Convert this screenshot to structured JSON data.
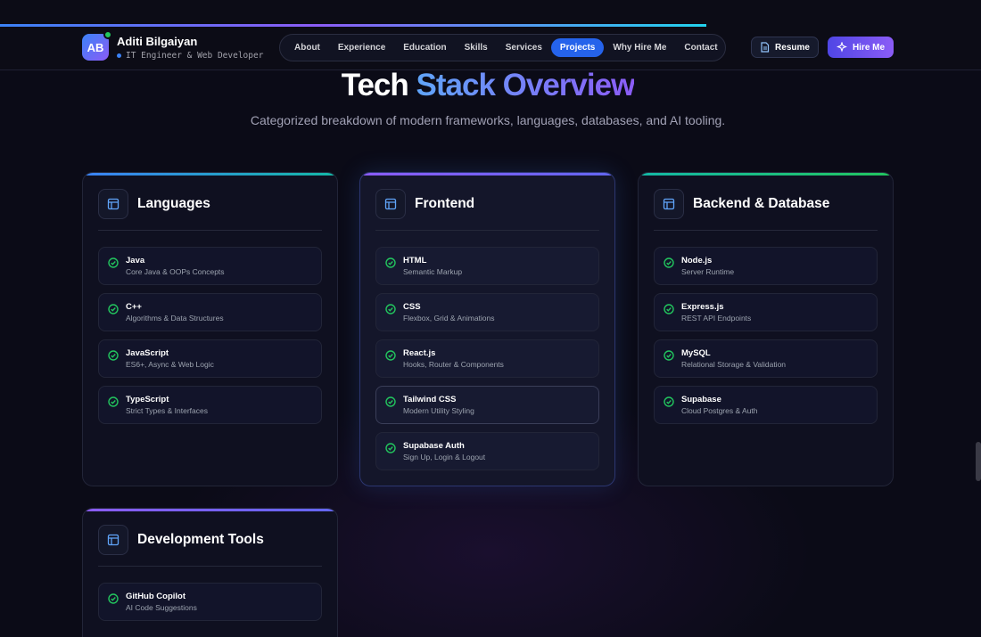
{
  "header": {
    "avatar_initials": "AB",
    "name": "Aditi Bilgaiyan",
    "role": "IT Engineer & Web Developer",
    "scroll_progress_percent": 72
  },
  "nav": {
    "items": [
      {
        "label": "About"
      },
      {
        "label": "Experience"
      },
      {
        "label": "Education"
      },
      {
        "label": "Skills"
      },
      {
        "label": "Services"
      },
      {
        "label": "Projects",
        "active": true
      },
      {
        "label": "Why Hire Me"
      },
      {
        "label": "Contact"
      }
    ]
  },
  "actions": {
    "resume_label": "Resume",
    "hire_label": "Hire Me"
  },
  "section": {
    "title_part1": "Tech",
    "title_part2": "Stack Overview",
    "subtitle": "Categorized breakdown of modern frameworks, languages, databases, and AI tooling."
  },
  "categories": [
    {
      "title": "Languages",
      "accent": "#3b82f6",
      "items": [
        {
          "name": "Java",
          "desc": "Core Java & OOPs Concepts"
        },
        {
          "name": "C++",
          "desc": "Algorithms & Data Structures"
        },
        {
          "name": "JavaScript",
          "desc": "ES6+, Async & Web Logic"
        },
        {
          "name": "TypeScript",
          "desc": "Strict Types & Interfaces"
        }
      ]
    },
    {
      "title": "Frontend",
      "accent": "#8b5cf6",
      "items": [
        {
          "name": "HTML",
          "desc": "Semantic Markup"
        },
        {
          "name": "CSS",
          "desc": "Flexbox, Grid & Animations"
        },
        {
          "name": "React.js",
          "desc": "Hooks, Router & Components"
        },
        {
          "name": "Tailwind CSS",
          "desc": "Modern Utility Styling"
        },
        {
          "name": "Supabase Auth",
          "desc": "Sign Up, Login & Logout"
        }
      ]
    },
    {
      "title": "Backend & Database",
      "accent": "#14b8a6",
      "items": [
        {
          "name": "Node.js",
          "desc": "Server Runtime"
        },
        {
          "name": "Express.js",
          "desc": "REST API Endpoints"
        },
        {
          "name": "MySQL",
          "desc": "Relational Storage & Validation"
        },
        {
          "name": "Supabase",
          "desc": "Cloud Postgres & Auth"
        }
      ]
    },
    {
      "title": "Development Tools",
      "accent": "#8b5cf6",
      "items": [
        {
          "name": "GitHub Copilot",
          "desc": "AI Code Suggestions"
        }
      ]
    }
  ],
  "colors": {
    "brand_blue": "#2563eb",
    "brand_purple": "#8b5cf6",
    "check_green": "#22c55e"
  },
  "icons": {
    "category": "layout-icon",
    "item": "check-circle-icon",
    "resume": "document-icon",
    "hire": "sparkle-icon"
  }
}
